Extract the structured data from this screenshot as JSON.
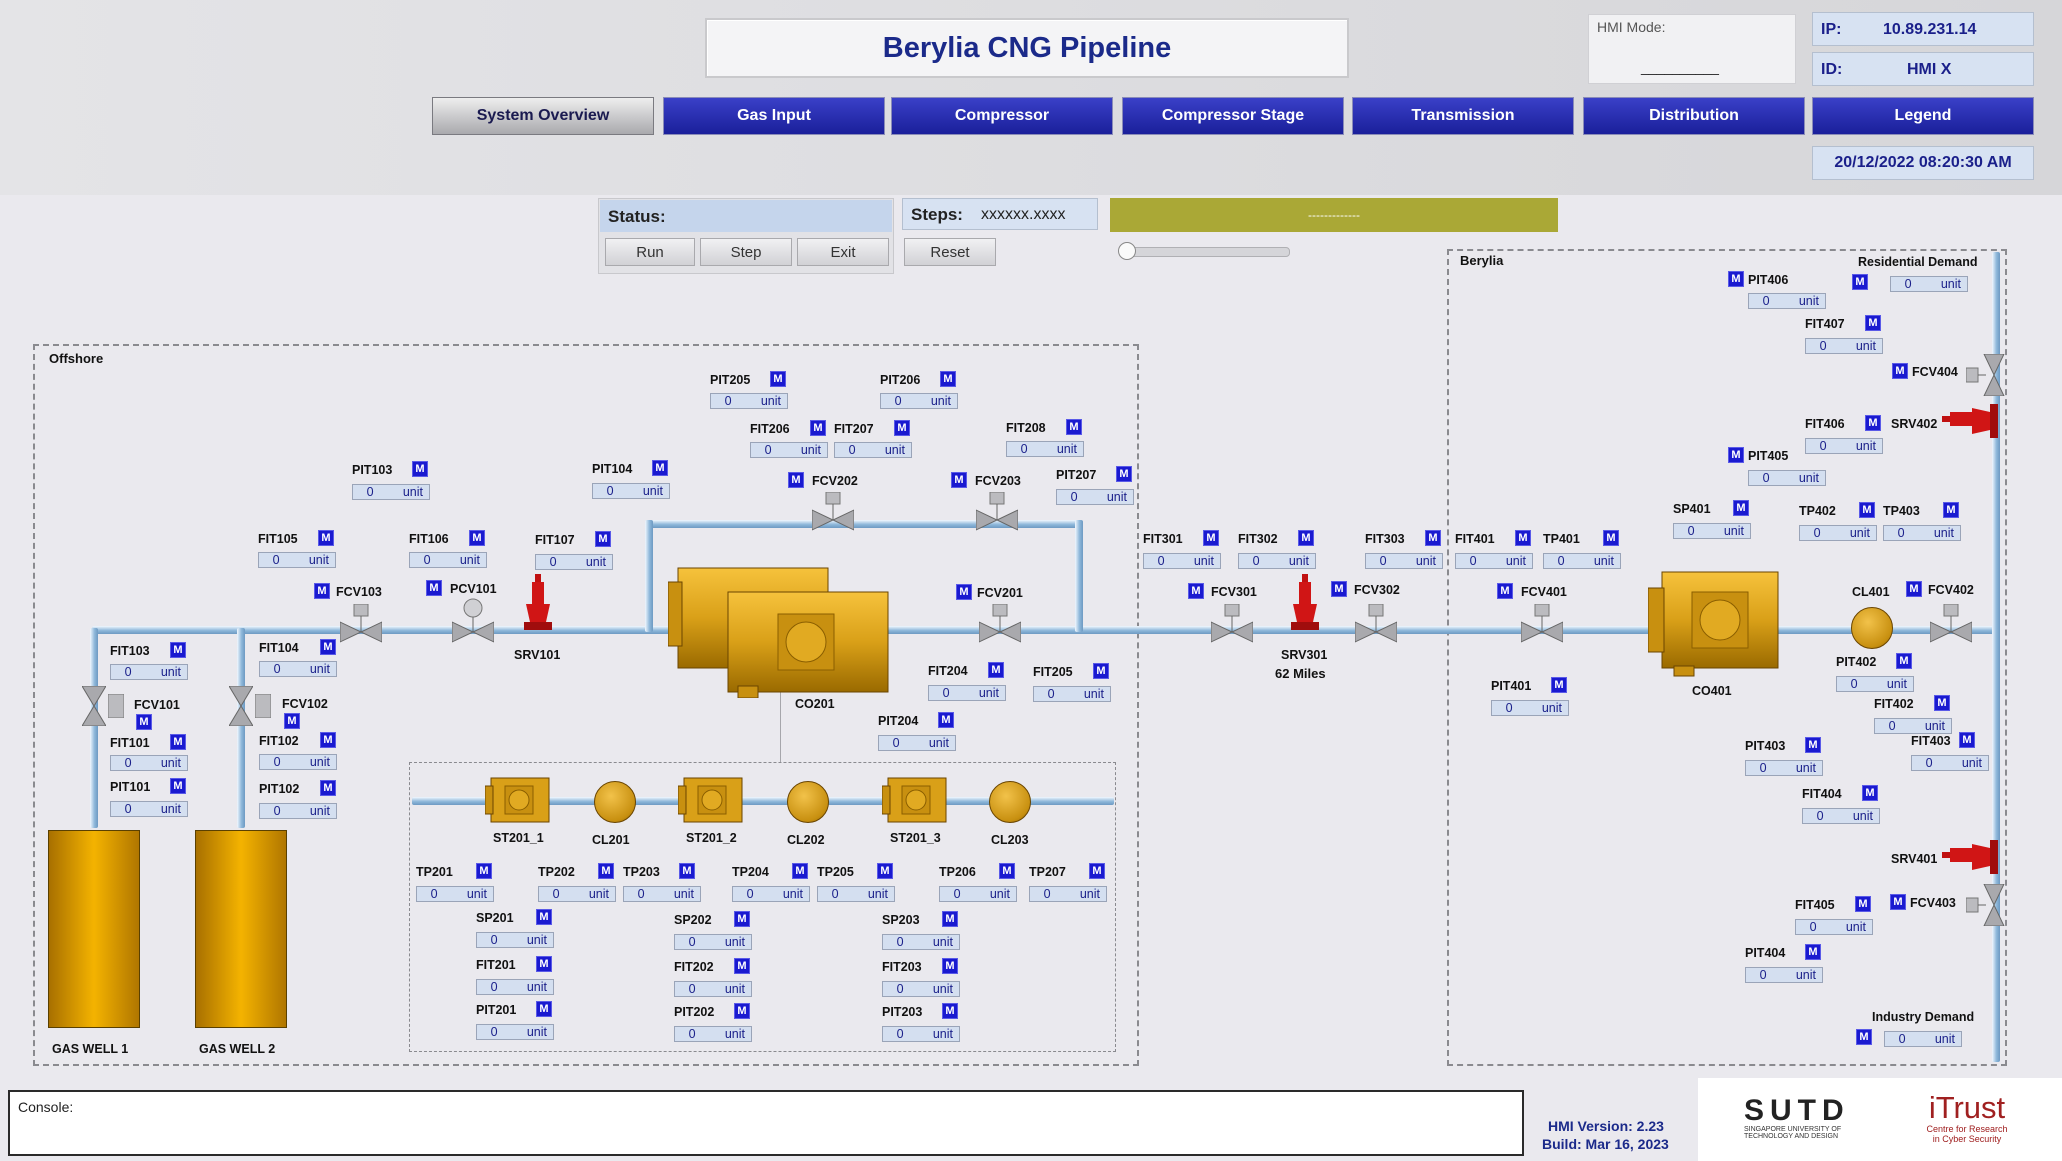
{
  "title": "Berylia CNG Pipeline",
  "hmi_mode": {
    "label": "HMI Mode:",
    "value": "__________"
  },
  "ip": {
    "label": "IP:",
    "value": "10.89.231.14"
  },
  "id": {
    "label": "ID:",
    "value": "HMI X"
  },
  "datetime": "20/12/2022 08:20:30 AM",
  "nav": [
    "System Overview",
    "Gas Input",
    "Compressor",
    "Compressor Stage",
    "Transmission",
    "Distribution",
    "Legend"
  ],
  "active_nav": "System Overview",
  "status": {
    "label": "Status:",
    "steps_label": "Steps:",
    "steps_value": "xxxxxx.xxxx",
    "banner": "-------------"
  },
  "buttons": {
    "run": "Run",
    "step": "Step",
    "exit": "Exit",
    "reset": "Reset"
  },
  "zones": {
    "offshore": "Offshore",
    "berylia": "Berylia"
  },
  "m_label": "M",
  "unit": "unit",
  "equipment": {
    "well1": "GAS WELL 1",
    "well2": "GAS WELL 2",
    "srv101": "SRV101",
    "co201": "CO201",
    "srv301": "SRV301",
    "srv301_sub": "62 Miles",
    "co401": "CO401",
    "cl401": "CL401",
    "srv402": "SRV402",
    "srv401": "SRV401",
    "st201_1": "ST201_1",
    "cl201": "CL201",
    "st201_2": "ST201_2",
    "cl202": "CL202",
    "st201_3": "ST201_3",
    "cl203": "CL203",
    "residential": "Residential Demand",
    "industry": "Industry Demand"
  },
  "instruments": {
    "FIT103": "0",
    "FIT101": "0",
    "PIT101": "0",
    "FIT104": "0",
    "FIT102": "0",
    "PIT102": "0",
    "FIT105": "0",
    "FIT106": "0",
    "FIT107": "0",
    "PIT103": "0",
    "PIT104": "0",
    "PIT205": "0",
    "PIT206": "0",
    "FIT206": "0",
    "FIT207": "0",
    "FIT208": "0",
    "PIT207": "0",
    "FIT204": "0",
    "FIT205": "0",
    "PIT204": "0",
    "TP201": "0",
    "TP202": "0",
    "TP203": "0",
    "TP204": "0",
    "TP205": "0",
    "TP206": "0",
    "TP207": "0",
    "SP201": "0",
    "FIT201": "0",
    "PIT201": "0",
    "SP202": "0",
    "FIT202": "0",
    "PIT202": "0",
    "SP203": "0",
    "FIT203": "0",
    "PIT203": "0",
    "FIT301": "0",
    "FIT302": "0",
    "FIT303": "0",
    "FIT401": "0",
    "TP401": "0",
    "PIT401": "0",
    "SP401": "0",
    "TP402": "0",
    "TP403": "0",
    "PIT406": "0",
    "RESD": "0",
    "FIT407": "0",
    "FIT406": "0",
    "PIT405": "0",
    "PIT402": "0",
    "FIT402": "0",
    "FIT403": "0",
    "PIT403": "0",
    "FIT404": "0",
    "FIT405": "0",
    "PIT404": "0",
    "INDD": "0"
  },
  "valve_tags": {
    "FCV101": "FCV101",
    "FCV102": "FCV102",
    "FCV103": "FCV103",
    "PCV101": "PCV101",
    "FCV202": "FCV202",
    "FCV203": "FCV203",
    "FCV201": "FCV201",
    "FCV301": "FCV301",
    "FCV302": "FCV302",
    "FCV401": "FCV401",
    "FCV402": "FCV402",
    "FCV403": "FCV403",
    "FCV404": "FCV404"
  },
  "console_label": "Console:",
  "version": "HMI Version: 2.23",
  "build": "Build: Mar 16, 2023",
  "logos": {
    "sutd": "SUTD",
    "sutd_sub1": "SINGAPORE UNIVERSITY OF",
    "sutd_sub2": "TECHNOLOGY AND DESIGN",
    "itrust": "iTrust",
    "itrust_sub1": "Centre for Research",
    "itrust_sub2": "in Cyber Security"
  },
  "colors": {
    "nav": "#1a1f9a",
    "m_button": "#1a1ad0",
    "valve_relief": "#d01515",
    "equipment": "#f4b300",
    "banner": "#aaa836"
  }
}
